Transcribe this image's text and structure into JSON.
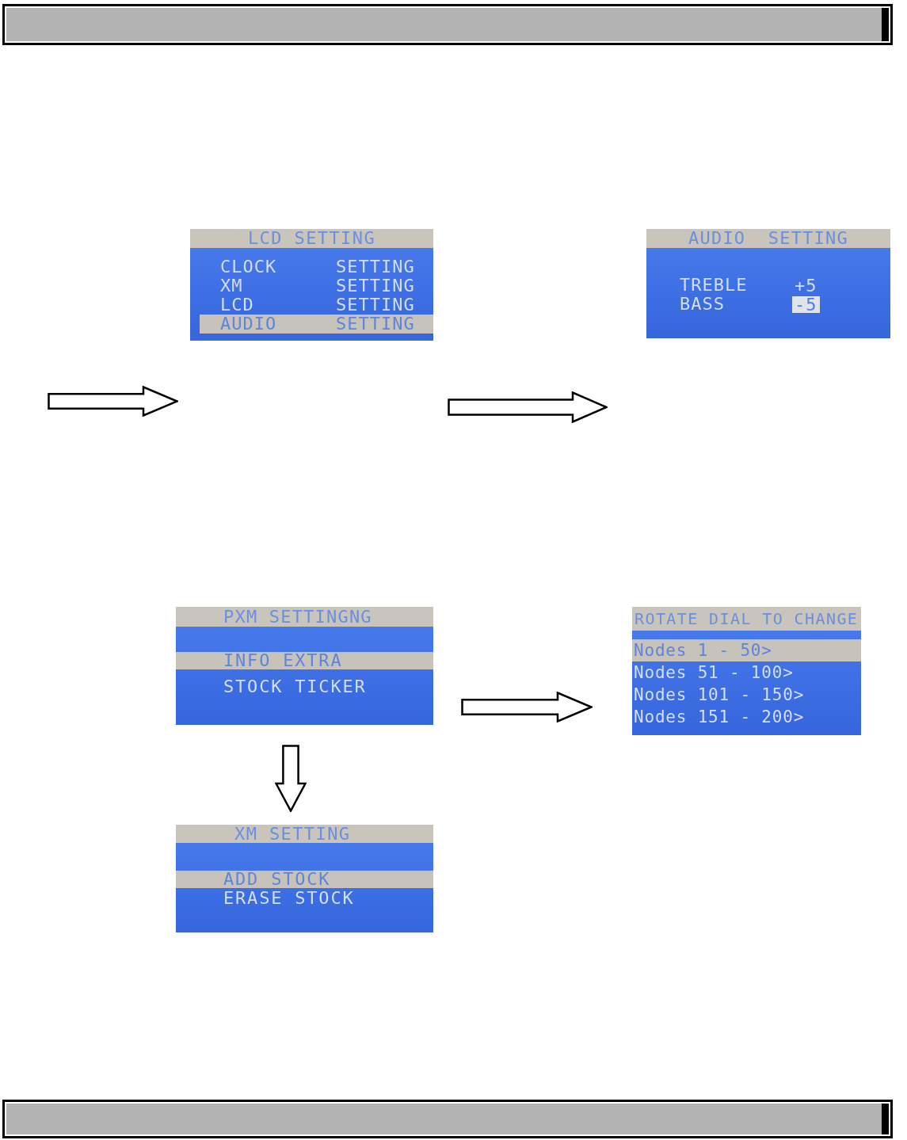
{
  "lcd_setting_screen": {
    "title": "LCD SETTING",
    "items": [
      {
        "label": "CLOCK",
        "value": "SETTING",
        "selected": false
      },
      {
        "label": "XM",
        "value": "SETTING",
        "selected": false
      },
      {
        "label": "LCD",
        "value": "SETTING",
        "selected": false
      },
      {
        "label": "AUDIO",
        "value": "SETTING",
        "selected": true
      }
    ]
  },
  "audio_setting_screen": {
    "title": "AUDIO SETTING",
    "items": [
      {
        "label": "TREBLE",
        "value": "+5",
        "selected": false
      },
      {
        "label": "BASS",
        "value": "-5",
        "selected": true
      }
    ]
  },
  "xm_menu_screen": {
    "title": "PXM SETTINGNG",
    "items": [
      {
        "label": "INFO EXTRA",
        "selected": true
      },
      {
        "label": "STOCK TICKER",
        "selected": false
      }
    ]
  },
  "node_select_screen": {
    "title": "ROTATE DIAL TO CHANGE",
    "items": [
      {
        "label": "Nodes 1 - 50>",
        "selected": true
      },
      {
        "label": "Nodes 51 - 100>",
        "selected": false
      },
      {
        "label": "Nodes 101 - 150>",
        "selected": false
      },
      {
        "label": "Nodes 151 - 200>",
        "selected": false
      }
    ]
  },
  "stock_screen": {
    "title": "XM SETTING",
    "items": [
      {
        "label": "ADD STOCK",
        "selected": true
      },
      {
        "label": "ERASE STOCK",
        "selected": false
      }
    ]
  }
}
